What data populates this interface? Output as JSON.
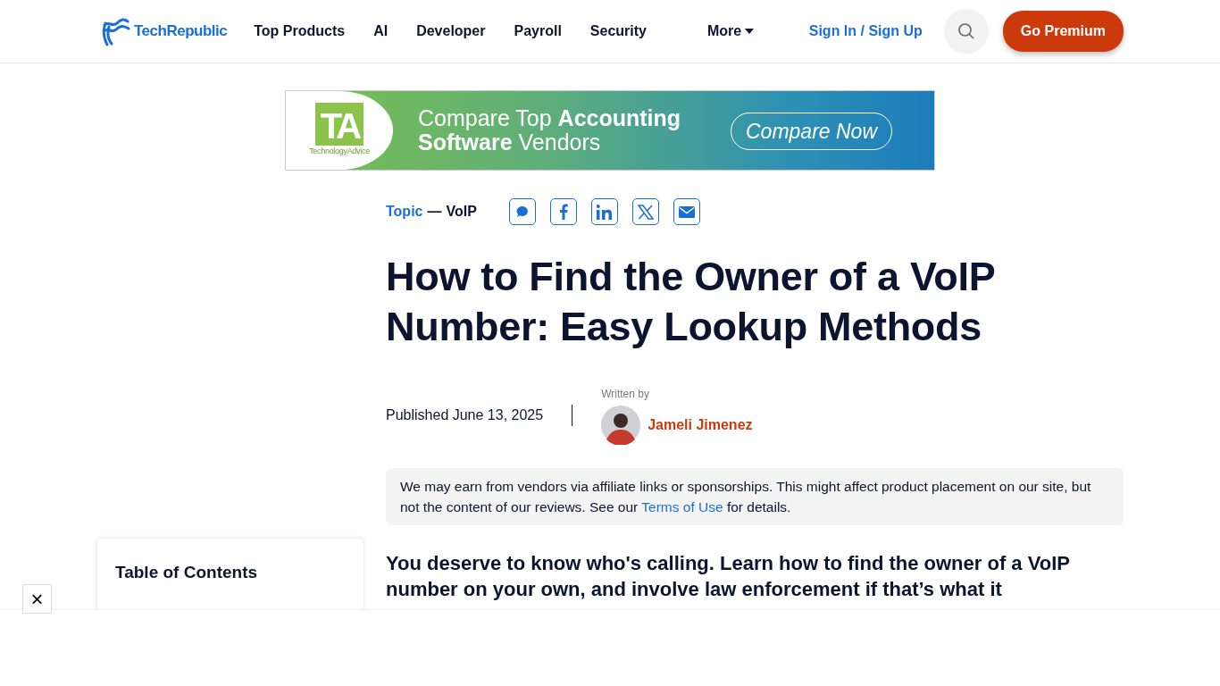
{
  "header": {
    "logo": "TechRepublic",
    "nav": [
      {
        "label": "Top Products",
        "dropdown": false
      },
      {
        "label": "AI",
        "dropdown": false
      },
      {
        "label": "Developer",
        "dropdown": false
      },
      {
        "label": "Payroll",
        "dropdown": false
      },
      {
        "label": "Security",
        "dropdown": false
      },
      {
        "label": "More",
        "dropdown": true
      }
    ],
    "sign_in": "Sign In / Sign Up",
    "premium": "Go Premium"
  },
  "ad_banner": {
    "logo_letters": "TA",
    "logo_name": "TechnologyAdvice",
    "headline": "Compare Top **Accounting** **Software** Vendors",
    "cta": "Compare Now"
  },
  "article": {
    "topic_label": "Topic",
    "topic_sep": "—",
    "topic": "VoIP",
    "share": [
      {
        "kind": "comment"
      },
      {
        "kind": "facebook"
      },
      {
        "kind": "linkedin"
      },
      {
        "kind": "x"
      },
      {
        "kind": "email"
      }
    ],
    "title": "How to Find the Owner of a VoIP Number: Easy Lookup Methods",
    "published": "Published June 13, 2025",
    "written_by": "Written by",
    "author": "Jameli Jimenez",
    "disclaimer": {
      "before": "We may earn from vendors via affiliate links or sponsorships. This might affect product placement on our site, but not the content of our reviews. See our",
      "link": "Terms of Use",
      "after": "for details."
    },
    "intro": "You deserve to know who's calling. Learn how to find the owner of a VoIP number on your own, and involve law enforcement if that’s what it"
  },
  "toc": {
    "title": "Table of Contents"
  },
  "overlay": {
    "close": "×"
  }
}
